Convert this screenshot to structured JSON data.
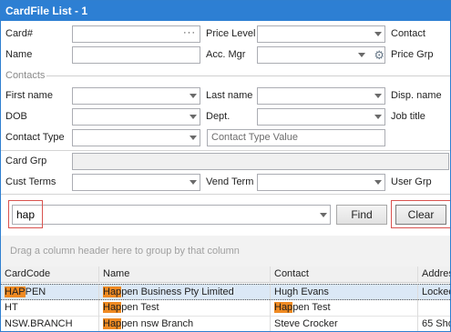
{
  "window": {
    "title": "CardFile List - 1"
  },
  "filters": {
    "card_label": "Card#",
    "price_level_label": "Price Level",
    "contact_label": "Contact",
    "name_label": "Name",
    "acc_mgr_label": "Acc. Mgr",
    "price_grp_label": "Price Grp",
    "contacts_group_label": "Contacts",
    "first_name_label": "First name",
    "last_name_label": "Last name",
    "disp_name_label": "Disp. name",
    "dob_label": "DOB",
    "dept_label": "Dept.",
    "job_title_label": "Job title",
    "contact_type_label": "Contact Type",
    "contact_type_value_placeholder": "Contact Type Value",
    "card_grp_label": "Card Grp",
    "cust_terms_label": "Cust Terms",
    "vend_term_label": "Vend Term",
    "user_grp_label": "User Grp"
  },
  "search": {
    "value": "hap",
    "find_label": "Find",
    "clear_label": "Clear"
  },
  "grid": {
    "group_hint": "Drag a column header here to group by that column",
    "columns": [
      "CardCode",
      "Name",
      "Contact",
      "Addres"
    ],
    "rows": [
      {
        "code_hl": "HAP",
        "code_rest": "PEN",
        "name_hl": "Hap",
        "name_rest": "pen Business Pty Limited",
        "contact_hl": "",
        "contact_rest": "Hugh Evans",
        "address": "Locked"
      },
      {
        "code_hl": "",
        "code_rest": "HT",
        "name_hl": "Hap",
        "name_rest": "pen Test",
        "contact_hl": "Hap",
        "contact_rest": "pen Test",
        "address": ""
      },
      {
        "code_hl": "",
        "code_rest": "NSW.BRANCH",
        "name_hl": "Hap",
        "name_rest": "pen nsw Branch",
        "contact_hl": "",
        "contact_rest": "Steve Crocker",
        "address": "65 Sho"
      }
    ]
  },
  "colors": {
    "title_bar": "#2d7fd3",
    "match_highlight": "#ef8a22",
    "selected_row": "#dbe8f6",
    "annotation_box": "#d9534f"
  }
}
